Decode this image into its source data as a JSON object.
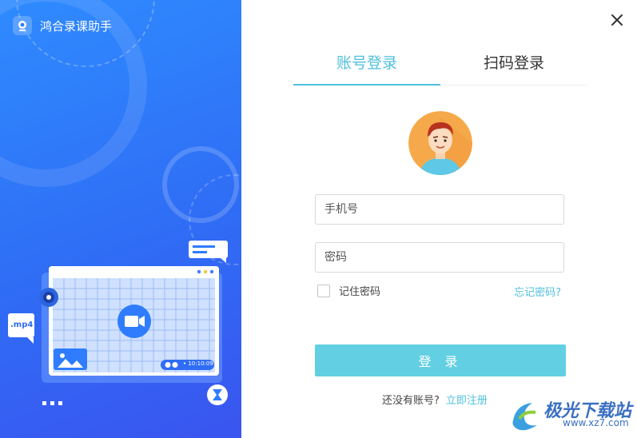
{
  "app": {
    "title": "鸿合录课助手"
  },
  "tabs": [
    {
      "label": "账号登录",
      "active": true
    },
    {
      "label": "扫码登录",
      "active": false
    }
  ],
  "form": {
    "phone_placeholder": "手机号",
    "phone_value": "",
    "password_placeholder": "密码",
    "password_value": "",
    "remember_label": "记住密码",
    "remember_checked": false,
    "forgot_label": "忘记密码?",
    "login_label": "登 录",
    "no_account_text": "还没有账号?",
    "register_link": "立即注册"
  },
  "illustration": {
    "file_badge": ".mp4",
    "timer": "• 10:10:09"
  },
  "watermark": {
    "brand": "极光下载站",
    "url": "www.xz7.com"
  },
  "colors": {
    "accent": "#4fc0dd",
    "button": "#62d0e2",
    "left_panel": "#2f7cff"
  }
}
